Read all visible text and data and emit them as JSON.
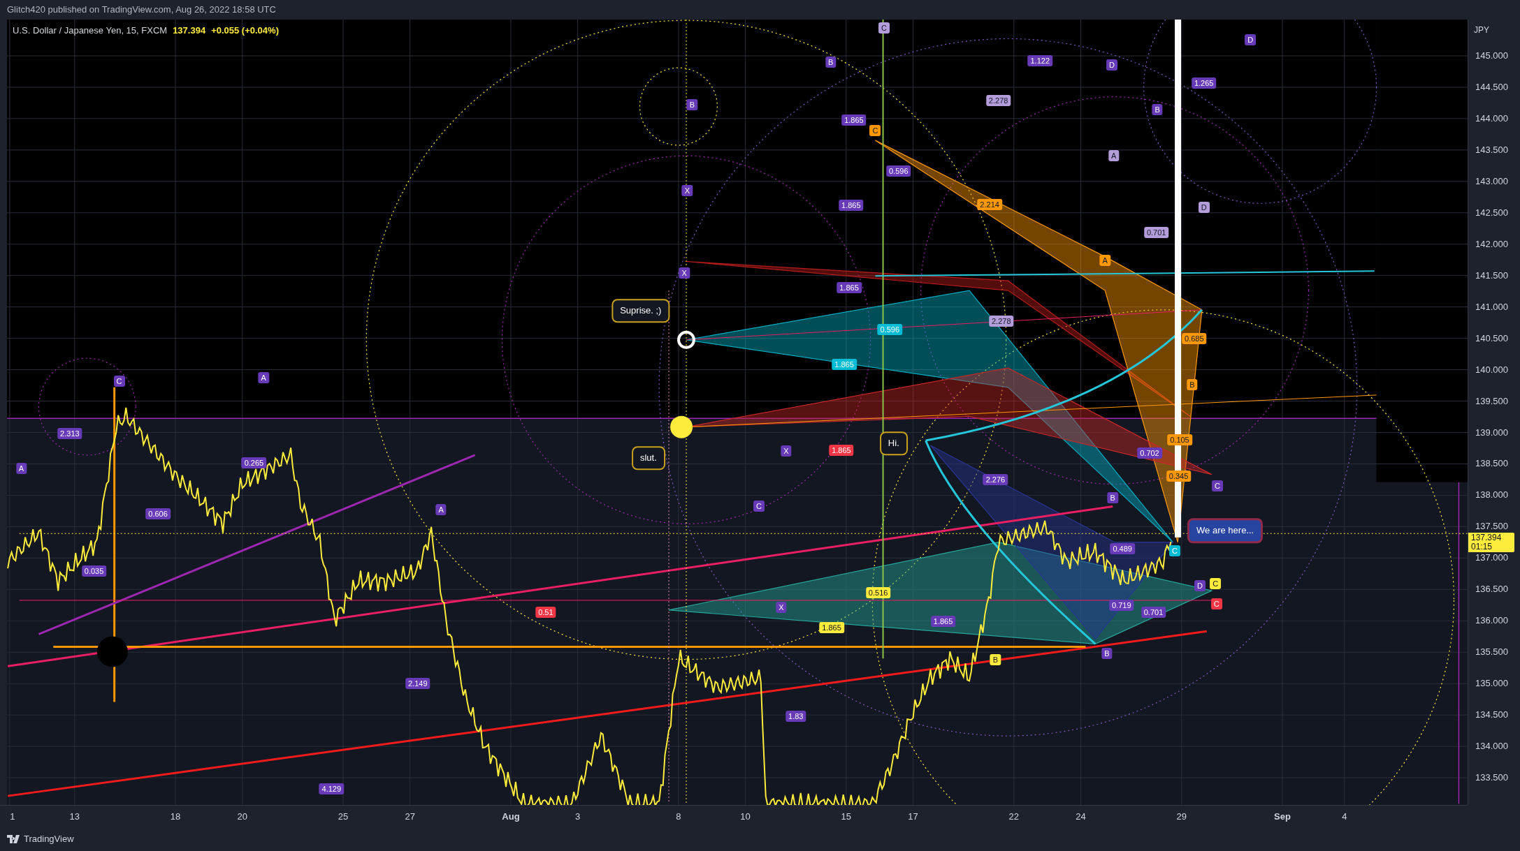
{
  "header": {
    "publisher": "Glitch420 published on TradingView.com, Aug 26, 2022 18:58 UTC"
  },
  "legend": {
    "symbol": "U.S. Dollar / Japanese Yen, 15, FXCM",
    "price": "137.394",
    "change": "+0.055 (+0.04%)"
  },
  "price_axis": {
    "currency": "JPY",
    "ticks": [
      "145.000",
      "144.500",
      "144.000",
      "143.500",
      "143.000",
      "142.500",
      "142.000",
      "141.500",
      "141.000",
      "140.500",
      "140.000",
      "139.500",
      "139.000",
      "138.500",
      "138.000",
      "137.500",
      "137.000",
      "136.500",
      "136.000",
      "135.500",
      "135.000",
      "134.500",
      "134.000",
      "133.500"
    ],
    "last_price": "137.394",
    "countdown": "01:15"
  },
  "time_axis": {
    "ticks": [
      {
        "label": "1",
        "month": false
      },
      {
        "label": "13",
        "month": false
      },
      {
        "label": "18",
        "month": false
      },
      {
        "label": "20",
        "month": false
      },
      {
        "label": "25",
        "month": false
      },
      {
        "label": "27",
        "month": false
      },
      {
        "label": "Aug",
        "month": true
      },
      {
        "label": "3",
        "month": false
      },
      {
        "label": "8",
        "month": false
      },
      {
        "label": "10",
        "month": false
      },
      {
        "label": "15",
        "month": false
      },
      {
        "label": "17",
        "month": false
      },
      {
        "label": "22",
        "month": false
      },
      {
        "label": "24",
        "month": false
      },
      {
        "label": "29",
        "month": false
      },
      {
        "label": "Sep",
        "month": true
      },
      {
        "label": "4",
        "month": false
      }
    ]
  },
  "callouts": [
    {
      "text": "Suprise. ;)",
      "kind": "dark"
    },
    {
      "text": "slut.",
      "kind": "dark"
    },
    {
      "text": "Hi.",
      "kind": "dark"
    },
    {
      "text": "We are here...",
      "kind": "blue"
    }
  ],
  "drawing_labels": [
    {
      "text": "C",
      "color": "#b39ddb"
    },
    {
      "text": "B",
      "color": "#673ab7"
    },
    {
      "text": "B",
      "color": "#673ab7"
    },
    {
      "text": "X",
      "color": "#673ab7"
    },
    {
      "text": "X",
      "color": "#673ab7"
    },
    {
      "text": "C",
      "color": "#ff9800"
    },
    {
      "text": "1.865",
      "color": "#673ab7"
    },
    {
      "text": "1.865",
      "color": "#673ab7"
    },
    {
      "text": "1.865",
      "color": "#673ab7"
    },
    {
      "text": "0.596",
      "color": "#673ab7"
    },
    {
      "text": "2.214",
      "color": "#ff9800"
    },
    {
      "text": "2.278",
      "color": "#b39ddb"
    },
    {
      "text": "2.278",
      "color": "#b39ddb"
    },
    {
      "text": "1.122",
      "color": "#673ab7"
    },
    {
      "text": "D",
      "color": "#673ab7"
    },
    {
      "text": "B",
      "color": "#673ab7"
    },
    {
      "text": "1.265",
      "color": "#673ab7"
    },
    {
      "text": "D",
      "color": "#673ab7"
    },
    {
      "text": "A",
      "color": "#b39ddb"
    },
    {
      "text": "D",
      "color": "#b39ddb"
    },
    {
      "text": "0.701",
      "color": "#b39ddb"
    },
    {
      "text": "A",
      "color": "#ff9800"
    },
    {
      "text": "0.685",
      "color": "#ff9800"
    },
    {
      "text": "B",
      "color": "#ff9800"
    },
    {
      "text": "0.105",
      "color": "#ff9800"
    },
    {
      "text": "0.345",
      "color": "#ff9800"
    },
    {
      "text": "C",
      "color": "#673ab7"
    },
    {
      "text": "1.865",
      "color": "#00bcd4"
    },
    {
      "text": "0.596",
      "color": "#00bcd4"
    },
    {
      "text": "X",
      "color": "#673ab7"
    },
    {
      "text": "1.865",
      "color": "#f23645"
    },
    {
      "text": "0.702",
      "color": "#673ab7"
    },
    {
      "text": "2.276",
      "color": "#673ab7"
    },
    {
      "text": "B",
      "color": "#673ab7"
    },
    {
      "text": "C",
      "color": "#673ab7"
    },
    {
      "text": "C",
      "color": "#673ab7"
    },
    {
      "text": "A",
      "color": "#673ab7"
    },
    {
      "text": "A",
      "color": "#673ab7"
    },
    {
      "text": "2.313",
      "color": "#673ab7"
    },
    {
      "text": "0.265",
      "color": "#673ab7"
    },
    {
      "text": "0.606",
      "color": "#673ab7"
    },
    {
      "text": "0.035",
      "color": "#673ab7"
    },
    {
      "text": "A",
      "color": "#673ab7"
    },
    {
      "text": "X",
      "color": "#673ab7"
    },
    {
      "text": "0.51",
      "color": "#f23645"
    },
    {
      "text": "1.865",
      "color": "#ffeb3b"
    },
    {
      "text": "0.516",
      "color": "#ffeb3b"
    },
    {
      "text": "1.865",
      "color": "#673ab7"
    },
    {
      "text": "2.149",
      "color": "#673ab7"
    },
    {
      "text": "1.83",
      "color": "#673ab7"
    },
    {
      "text": "4.129",
      "color": "#673ab7"
    },
    {
      "text": "B",
      "color": "#ffeb3b"
    },
    {
      "text": "B",
      "color": "#673ab7"
    },
    {
      "text": "0.719",
      "color": "#673ab7"
    },
    {
      "text": "0.701",
      "color": "#673ab7"
    },
    {
      "text": "C",
      "color": "#ffeb3b"
    },
    {
      "text": "C",
      "color": "#f23645"
    },
    {
      "text": "D",
      "color": "#673ab7"
    },
    {
      "text": "C",
      "color": "#00bcd4"
    },
    {
      "text": "0.489",
      "color": "#673ab7"
    }
  ],
  "footer": {
    "brand": "TradingView"
  }
}
